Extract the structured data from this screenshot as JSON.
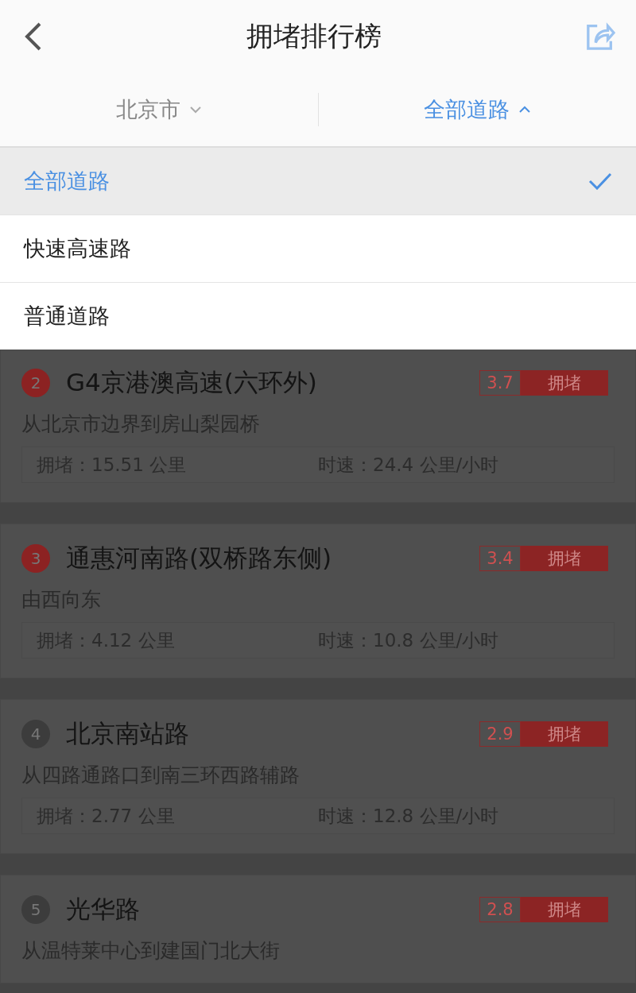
{
  "header": {
    "title": "拥堵排行榜"
  },
  "filters": [
    {
      "label": "北京市",
      "expanded": false
    },
    {
      "label": "全部道路",
      "expanded": true
    }
  ],
  "menu": [
    {
      "label": "全部道路",
      "selected": true
    },
    {
      "label": "快速高速路",
      "selected": false
    },
    {
      "label": "普通道路",
      "selected": false
    }
  ],
  "roads": [
    {
      "rank": "2",
      "color": "#8c2222",
      "name": "G4京港澳高速(六环外)",
      "index": "3.7",
      "status": "拥堵",
      "route": "从北京市边界到房山梨园桥",
      "length": "拥堵：15.51 公里",
      "speed": "时速：24.4 公里/小时"
    },
    {
      "rank": "3",
      "color": "#8c2222",
      "name": "通惠河南路(双桥路东侧)",
      "index": "3.4",
      "status": "拥堵",
      "route": "由西向东",
      "length": "拥堵：4.12 公里",
      "speed": "时速：10.8 公里/小时"
    },
    {
      "rank": "4",
      "color": "#3c3c3c",
      "name": "北京南站路",
      "index": "2.9",
      "status": "拥堵",
      "route": "从四路通路口到南三环西路辅路",
      "length": "拥堵：2.77 公里",
      "speed": "时速：12.8 公里/小时"
    },
    {
      "rank": "5",
      "color": "#3c3c3c",
      "name": "光华路",
      "index": "2.8",
      "status": "拥堵",
      "route": "从温特莱中心到建国门北大街"
    }
  ]
}
